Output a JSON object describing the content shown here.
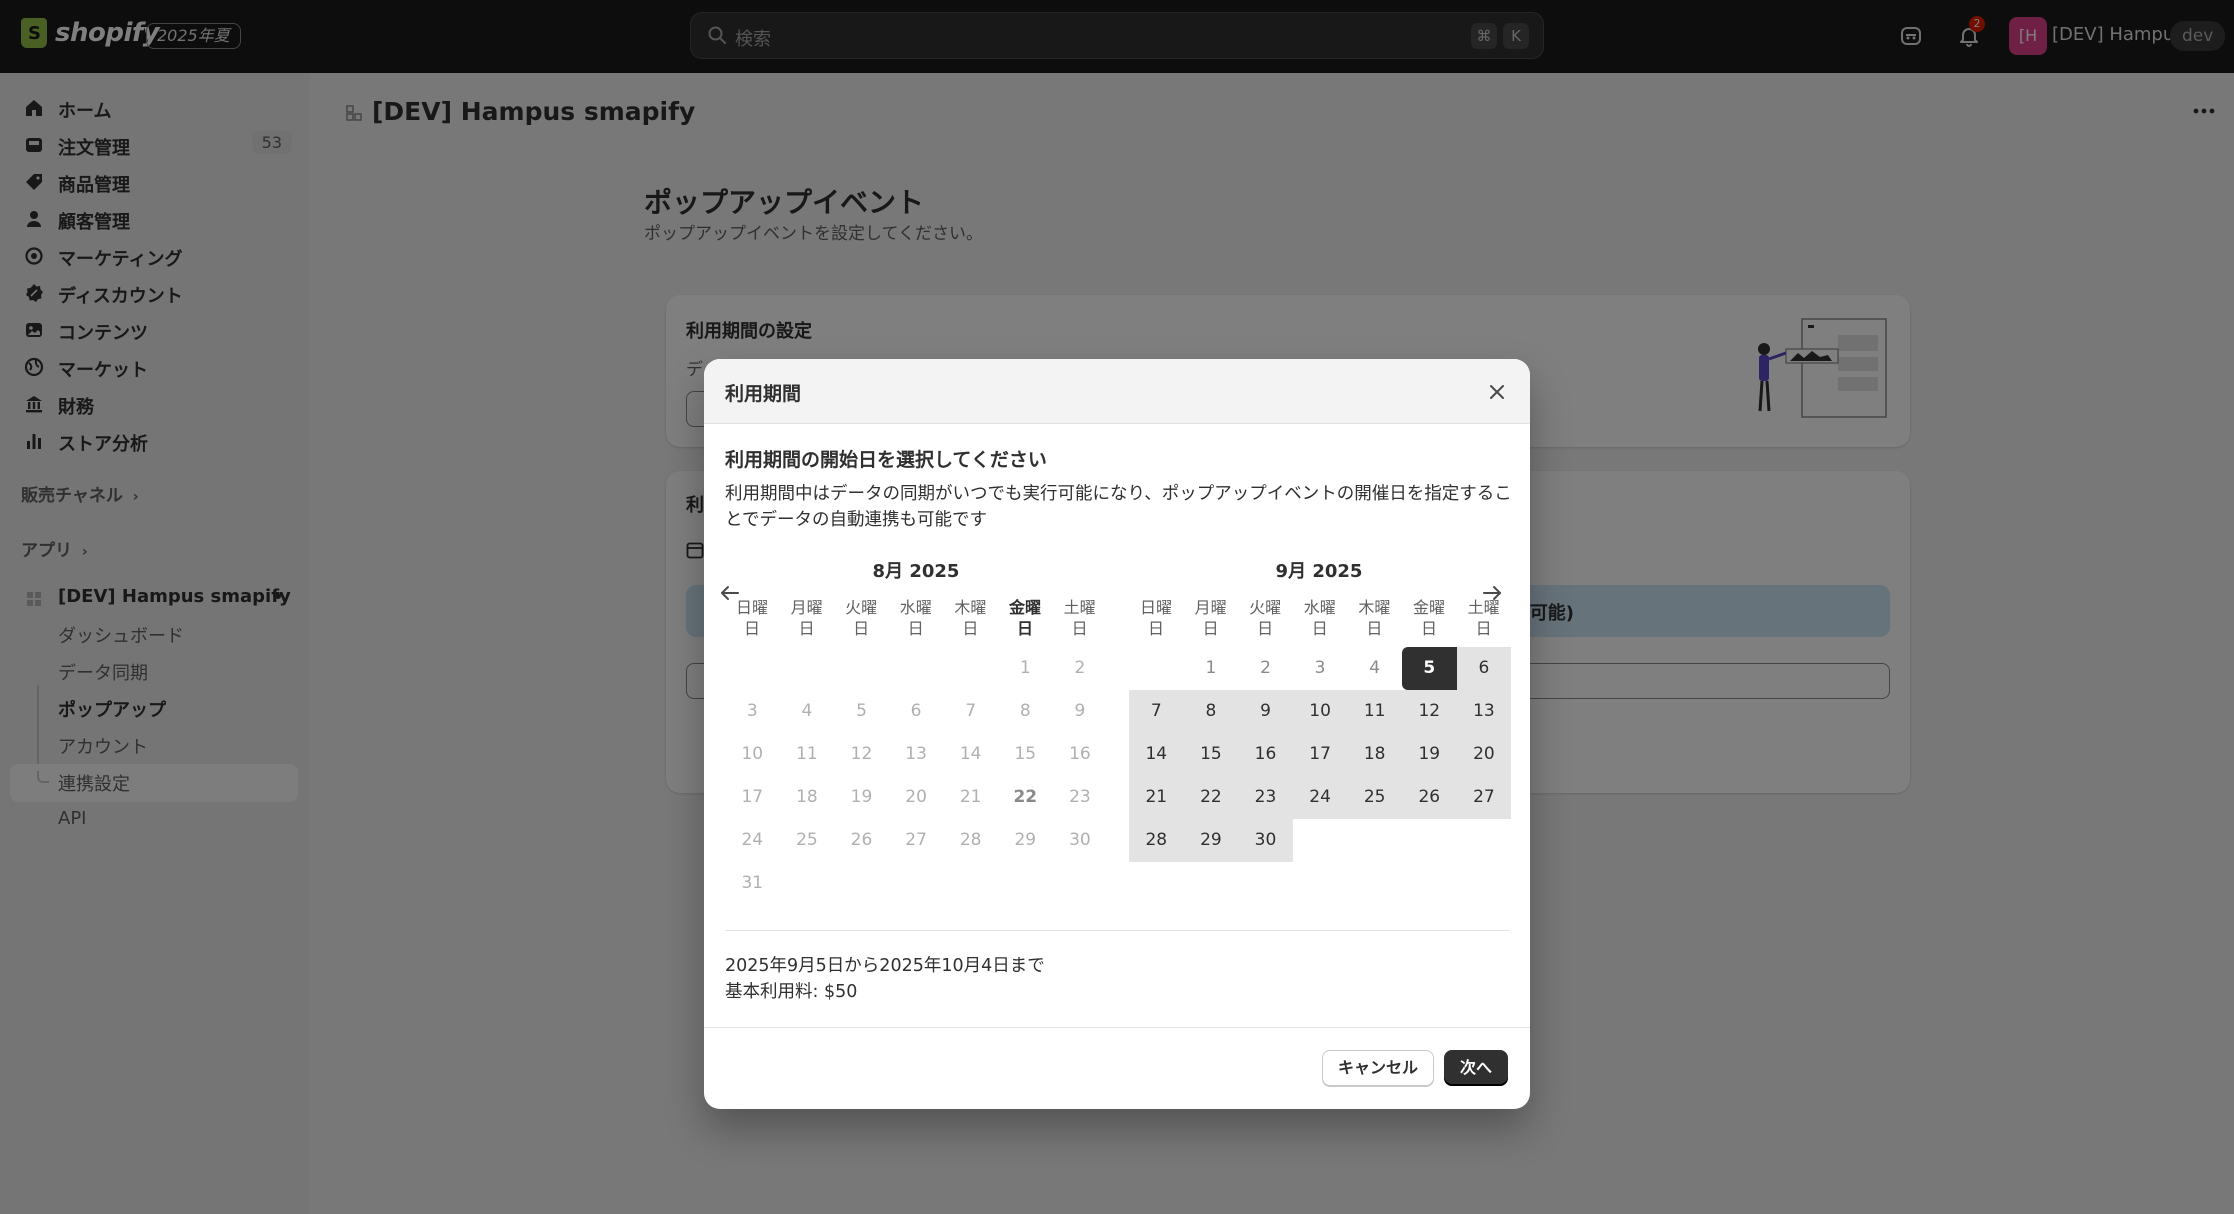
{
  "topbar": {
    "logo_text": "shopify",
    "season_badge": "2025年夏",
    "search_placeholder": "検索",
    "shortcut_key1": "⌘",
    "shortcut_key2": "K",
    "notification_count": "2",
    "avatar_initials": "[H",
    "user_name": "[DEV] Hampus",
    "dev_badge": "dev"
  },
  "sidebar": {
    "items": [
      {
        "label": "ホーム",
        "icon": "home-icon"
      },
      {
        "label": "注文管理",
        "icon": "inbox-icon",
        "count": "53"
      },
      {
        "label": "商品管理",
        "icon": "tag-icon"
      },
      {
        "label": "顧客管理",
        "icon": "person-icon"
      },
      {
        "label": "マーケティング",
        "icon": "target-icon"
      },
      {
        "label": "ディスカウント",
        "icon": "discount-icon"
      },
      {
        "label": "コンテンツ",
        "icon": "content-icon"
      },
      {
        "label": "マーケット",
        "icon": "globe-icon"
      },
      {
        "label": "財務",
        "icon": "bank-icon"
      },
      {
        "label": "ストア分析",
        "icon": "chart-icon"
      }
    ],
    "sales_channels_label": "販売チャネル",
    "apps_label": "アプリ",
    "app_name": "[DEV] Hampus smapify",
    "app_subitems": [
      "ダッシュボード",
      "データ同期",
      "ポップアップ",
      "アカウント",
      "連携設定",
      "API"
    ]
  },
  "main": {
    "header_title": "[DEV] Hampus smapify",
    "page_title": "ポップアップイベント",
    "page_subtitle": "ポップアップイベントを設定してください。",
    "card1_title": "利用期間の設定",
    "card1_desc": "デ",
    "card2_title": "利",
    "card2_banner_text": "可能)"
  },
  "modal": {
    "title": "利用期間",
    "heading": "利用期間の開始日を選択してください",
    "description": "利用期間中はデータの同期がいつでも実行可能になり、ポップアップイベントの開催日を指定することでデータの自動連携も可能です",
    "weekday_labels": [
      "日曜日",
      "月曜日",
      "火曜日",
      "水曜日",
      "木曜日",
      "金曜日",
      "土曜日"
    ],
    "months": [
      {
        "title": "8月 2025",
        "first_weekday": 5,
        "days": 31,
        "today": 22
      },
      {
        "title": "9月 2025",
        "first_weekday": 1,
        "days": 30,
        "selected": 5
      }
    ],
    "range_text": "2025年9月5日から2025年10月4日まで",
    "fee_text": "基本利用料: $50",
    "cancel_label": "キャンセル",
    "next_label": "次へ"
  }
}
